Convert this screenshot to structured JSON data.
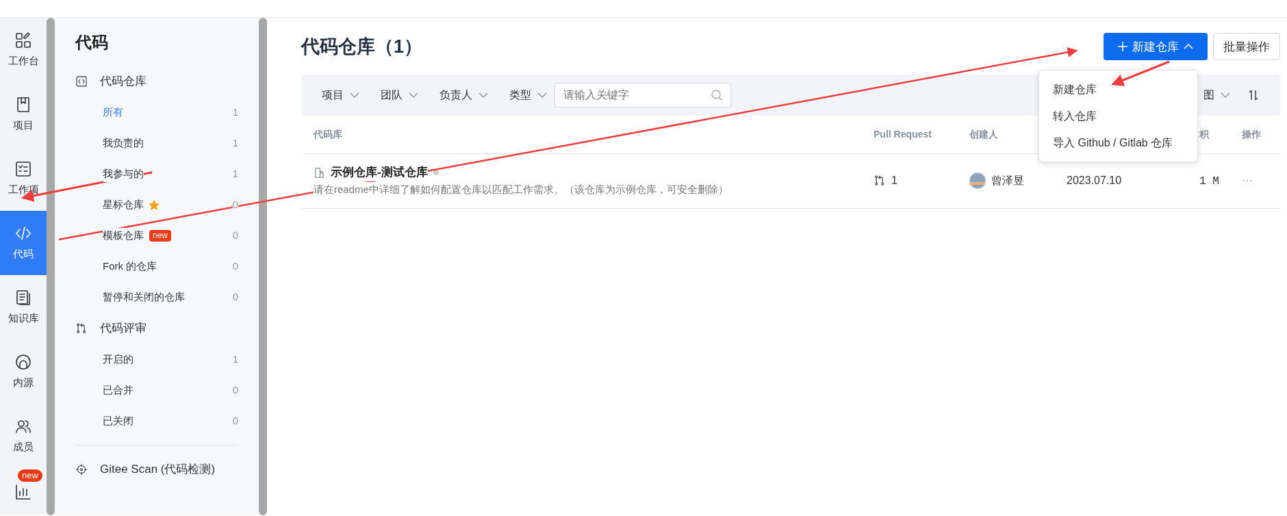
{
  "rail": [
    {
      "label": "工作台",
      "selected": false
    },
    {
      "label": "项目",
      "selected": false
    },
    {
      "label": "工作项",
      "selected": false
    },
    {
      "label": "代码",
      "selected": true
    },
    {
      "label": "知识库",
      "selected": false
    },
    {
      "label": "内源",
      "selected": false
    },
    {
      "label": "成员",
      "selected": false
    },
    {
      "badge": "new",
      "selected": false
    }
  ],
  "sidebar": {
    "title": "代码",
    "sections": [
      {
        "label": "代码仓库",
        "items": [
          {
            "label": "所有",
            "count": "1",
            "selected": true
          },
          {
            "label": "我负责的",
            "count": "1",
            "selected": false
          },
          {
            "label": "我参与的",
            "count": "1",
            "selected": false
          },
          {
            "label": "星标仓库",
            "count": "0",
            "selected": false,
            "starred": true
          },
          {
            "label": "模板仓库",
            "count": "0",
            "selected": false,
            "badge": "new"
          },
          {
            "label": "Fork 的仓库",
            "count": "0",
            "selected": false
          },
          {
            "label": "暂停和关闭的仓库",
            "count": "0",
            "selected": false
          }
        ]
      },
      {
        "label": "代码评审",
        "items": [
          {
            "label": "开启的",
            "count": "1",
            "selected": false
          },
          {
            "label": "已合并",
            "count": "0",
            "selected": false
          },
          {
            "label": "已关闭",
            "count": "0",
            "selected": false
          }
        ]
      },
      {
        "label": "Gitee Scan (代码检测)"
      }
    ]
  },
  "main": {
    "title": "代码仓库（1）",
    "new_button": {
      "label": "新建仓库",
      "expanded": true
    },
    "batch_button": "批量操作",
    "filters": [
      "项目",
      "团队",
      "负责人",
      "类型"
    ],
    "search": {
      "placeholder": "请输入关键字"
    },
    "view_label": "图",
    "menu": [
      "新建仓库",
      "转入仓库",
      "导入 Github / Gitlab 仓库"
    ],
    "table": {
      "columns": [
        "代码库",
        "Pull Request",
        "创建人",
        "积",
        "操作"
      ],
      "rows": [
        {
          "name": "示例仓库-测试仓库",
          "description": "请在readme中详细了解如何配置仓库以匹配工作需求。（该仓库为示例仓库，可安全删除）",
          "pull_requests": "1",
          "creator": "曾泽昱",
          "date": "2023.07.10",
          "size": "1 M",
          "more": "···"
        }
      ]
    }
  }
}
